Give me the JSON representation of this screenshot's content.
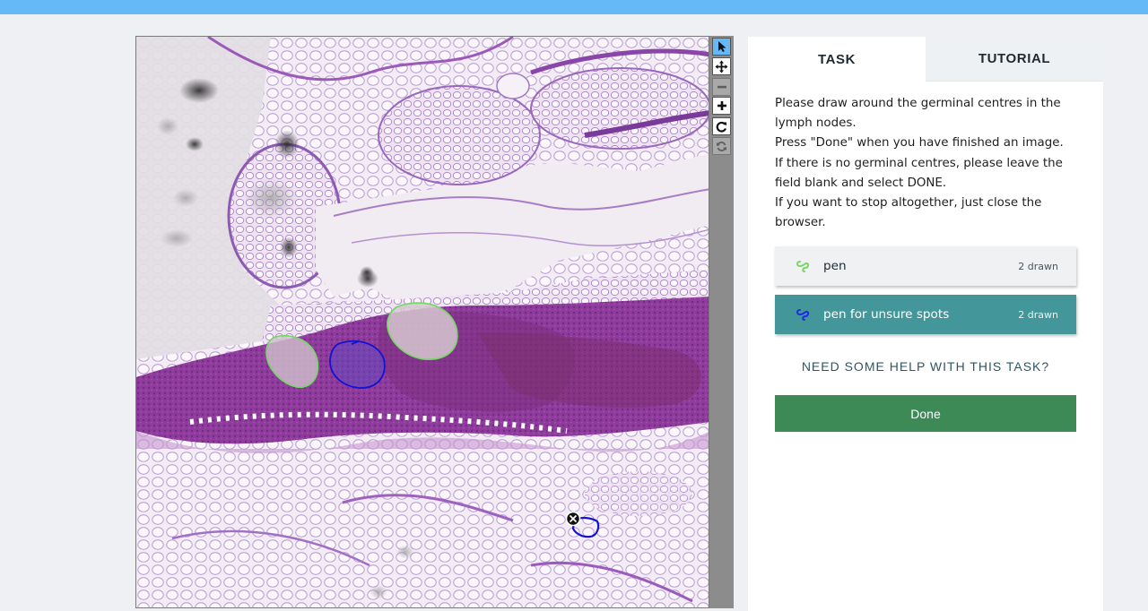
{
  "toolbar": {
    "tools": [
      {
        "name": "select-tool",
        "icon": "arrow-pointer-icon",
        "active": true
      },
      {
        "name": "move-tool",
        "icon": "move-arrows-icon"
      },
      {
        "name": "zoom-out-tool",
        "icon": "minus-icon",
        "disabled": true
      },
      {
        "name": "zoom-in-tool",
        "icon": "plus-icon"
      },
      {
        "name": "rotate-tool",
        "icon": "rotate-icon"
      },
      {
        "name": "reset-tool",
        "icon": "refresh-icon",
        "disabled": true
      }
    ]
  },
  "tabs": {
    "task": "TASK",
    "tutorial": "TUTORIAL"
  },
  "instructions": [
    "Please draw around the germinal centres in the",
    "lymph nodes.",
    "Press \"Done\" when you have finished an image.",
    "If there is no germinal centres, please leave the",
    "field blank and select DONE.",
    "If you want to stop altogether, just close the",
    "browser."
  ],
  "tool_options": [
    {
      "label": "pen",
      "count": "2 drawn",
      "color": "#7ed36b",
      "icon": "freehand-line-icon",
      "selected": false
    },
    {
      "label": "pen for unsure spots",
      "count": "2 drawn",
      "color": "#1a2ee0",
      "icon": "freehand-line-icon",
      "selected": true
    }
  ],
  "help_link": "NEED SOME HELP WITH THIS TASK?",
  "done_button": "Done",
  "colors": {
    "topbar": "#66b9f7",
    "selected_option": "#43979a",
    "done_button": "#3e8a56",
    "green_outline": "#6edb5e",
    "blue_outline": "#1212d6"
  }
}
